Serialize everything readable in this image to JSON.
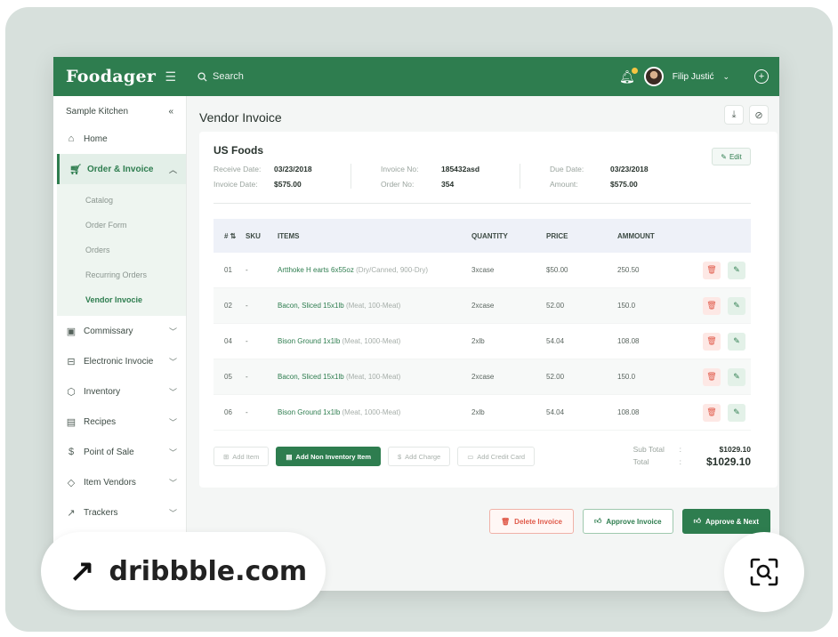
{
  "app": {
    "brand": "Foodager",
    "search_placeholder": "Search",
    "user_name": "Filip Justić"
  },
  "sidebar": {
    "kitchen": "Sample Kitchen",
    "items": [
      {
        "label": "Home",
        "icon": "home-icon"
      },
      {
        "label": "Order & Invoice",
        "icon": "cart-icon"
      },
      {
        "label": "Commissary",
        "icon": "box-icon"
      },
      {
        "label": "Electronic Invocie",
        "icon": "book-icon"
      },
      {
        "label": "Inventory",
        "icon": "cube-icon"
      },
      {
        "label": "Recipes",
        "icon": "file-icon"
      },
      {
        "label": "Point of Sale",
        "icon": "dollar-icon"
      },
      {
        "label": "Item Vendors",
        "icon": "tag-icon"
      },
      {
        "label": "Trackers",
        "icon": "chart-icon"
      }
    ],
    "subitems": [
      "Catalog",
      "Order Form",
      "Orders",
      "Recurring Orders",
      "Vendor Invocie"
    ]
  },
  "page": {
    "title": "Vendor Invoice"
  },
  "invoice": {
    "vendor": "US Foods",
    "edit_label": "Edit",
    "receive_date_label": "Receive Date:",
    "receive_date": "03/23/2018",
    "invoice_date_label": "Invoice Date:",
    "invoice_date": "$575.00",
    "invoice_no_label": "Invoice No:",
    "invoice_no": "185432asd",
    "order_no_label": "Order No:",
    "order_no": "354",
    "due_date_label": "Due Date:",
    "due_date": "03/23/2018",
    "amount_label": "Amount:",
    "amount": "$575.00"
  },
  "table": {
    "headers": {
      "no": "# ⇅",
      "sku": "SKU",
      "items": "ITEMS",
      "quantity": "QUANTITY",
      "price": "PRICE",
      "amount": "AMMOUNT"
    },
    "rows": [
      {
        "no": "01",
        "sku": "-",
        "item": "Artthoke H earts 6x55oz",
        "desc": "(Dry/Canned, 900-Dry)",
        "qty": "3xcase",
        "price": "$50.00",
        "amount": "250.50"
      },
      {
        "no": "02",
        "sku": "-",
        "item": "Bacon, Sliced 15x1lb",
        "desc": "(Meat, 100-Meat)",
        "qty": "2xcase",
        "price": "52.00",
        "amount": "150.0"
      },
      {
        "no": "04",
        "sku": "-",
        "item": "Bison Ground 1x1lb",
        "desc": "(Meat, 1000-Meat)",
        "qty": "2xlb",
        "price": "54.04",
        "amount": "108.08"
      },
      {
        "no": "05",
        "sku": "-",
        "item": "Bacon, Sliced 15x1lb",
        "desc": "(Meat, 100-Meat)",
        "qty": "2xcase",
        "price": "52.00",
        "amount": "150.0"
      },
      {
        "no": "06",
        "sku": "-",
        "item": "Bison Ground 1x1lb",
        "desc": "(Meat, 1000-Meat)",
        "qty": "2xlb",
        "price": "54.04",
        "amount": "108.08"
      }
    ]
  },
  "actions": {
    "add_item": "Add Item",
    "add_non_inventory": "Add Non Inventory Item",
    "add_charge": "Add Charge",
    "add_credit": "Add Credit Card"
  },
  "totals": {
    "subtotal_label": "Sub Total",
    "subtotal": "$1029.10",
    "total_label": "Total",
    "total": "$1029.10"
  },
  "footer": {
    "delete": "Delete Invoice",
    "approve": "Approve Invoice",
    "approve_next": "Approve & Next"
  },
  "overlay": {
    "source": "dribbble.com"
  },
  "colors": {
    "brand_green": "#2e7d4f",
    "delete_red": "#e05a4a",
    "background": "#d7e0dc"
  }
}
